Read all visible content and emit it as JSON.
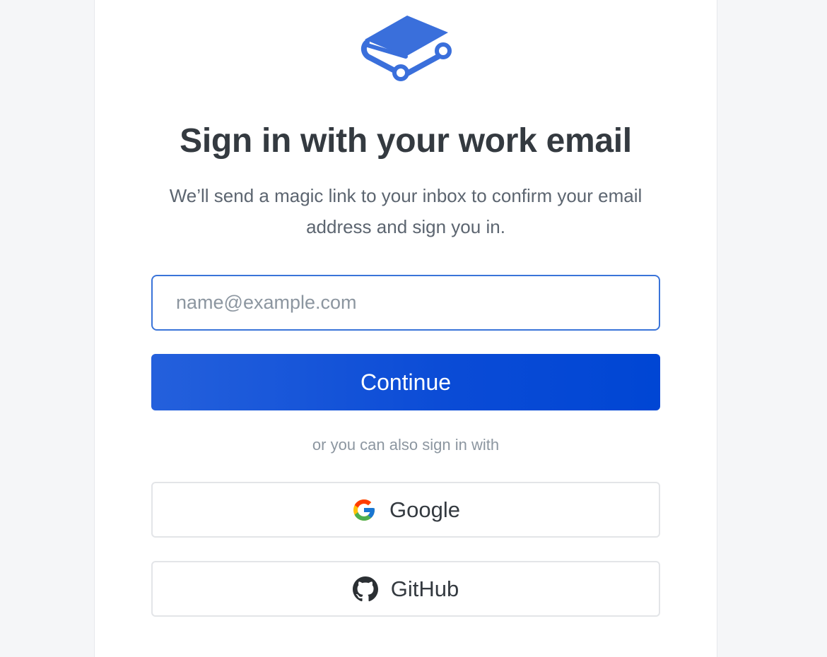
{
  "heading": "Sign in with your work email",
  "subheading": "We’ll send a magic link to your inbox to confirm your email address and sign you in.",
  "email": {
    "placeholder": "name@example.com",
    "value": ""
  },
  "continue_label": "Continue",
  "alt_text": "or you can also sign in with",
  "providers": {
    "google": {
      "label": "Google",
      "icon": "google-icon"
    },
    "github": {
      "label": "GitHub",
      "icon": "github-icon"
    }
  },
  "colors": {
    "brand": "#3a6fdb",
    "primary_button": "#0a4bd6",
    "heading": "#343a40",
    "muted": "#8c96a0"
  }
}
